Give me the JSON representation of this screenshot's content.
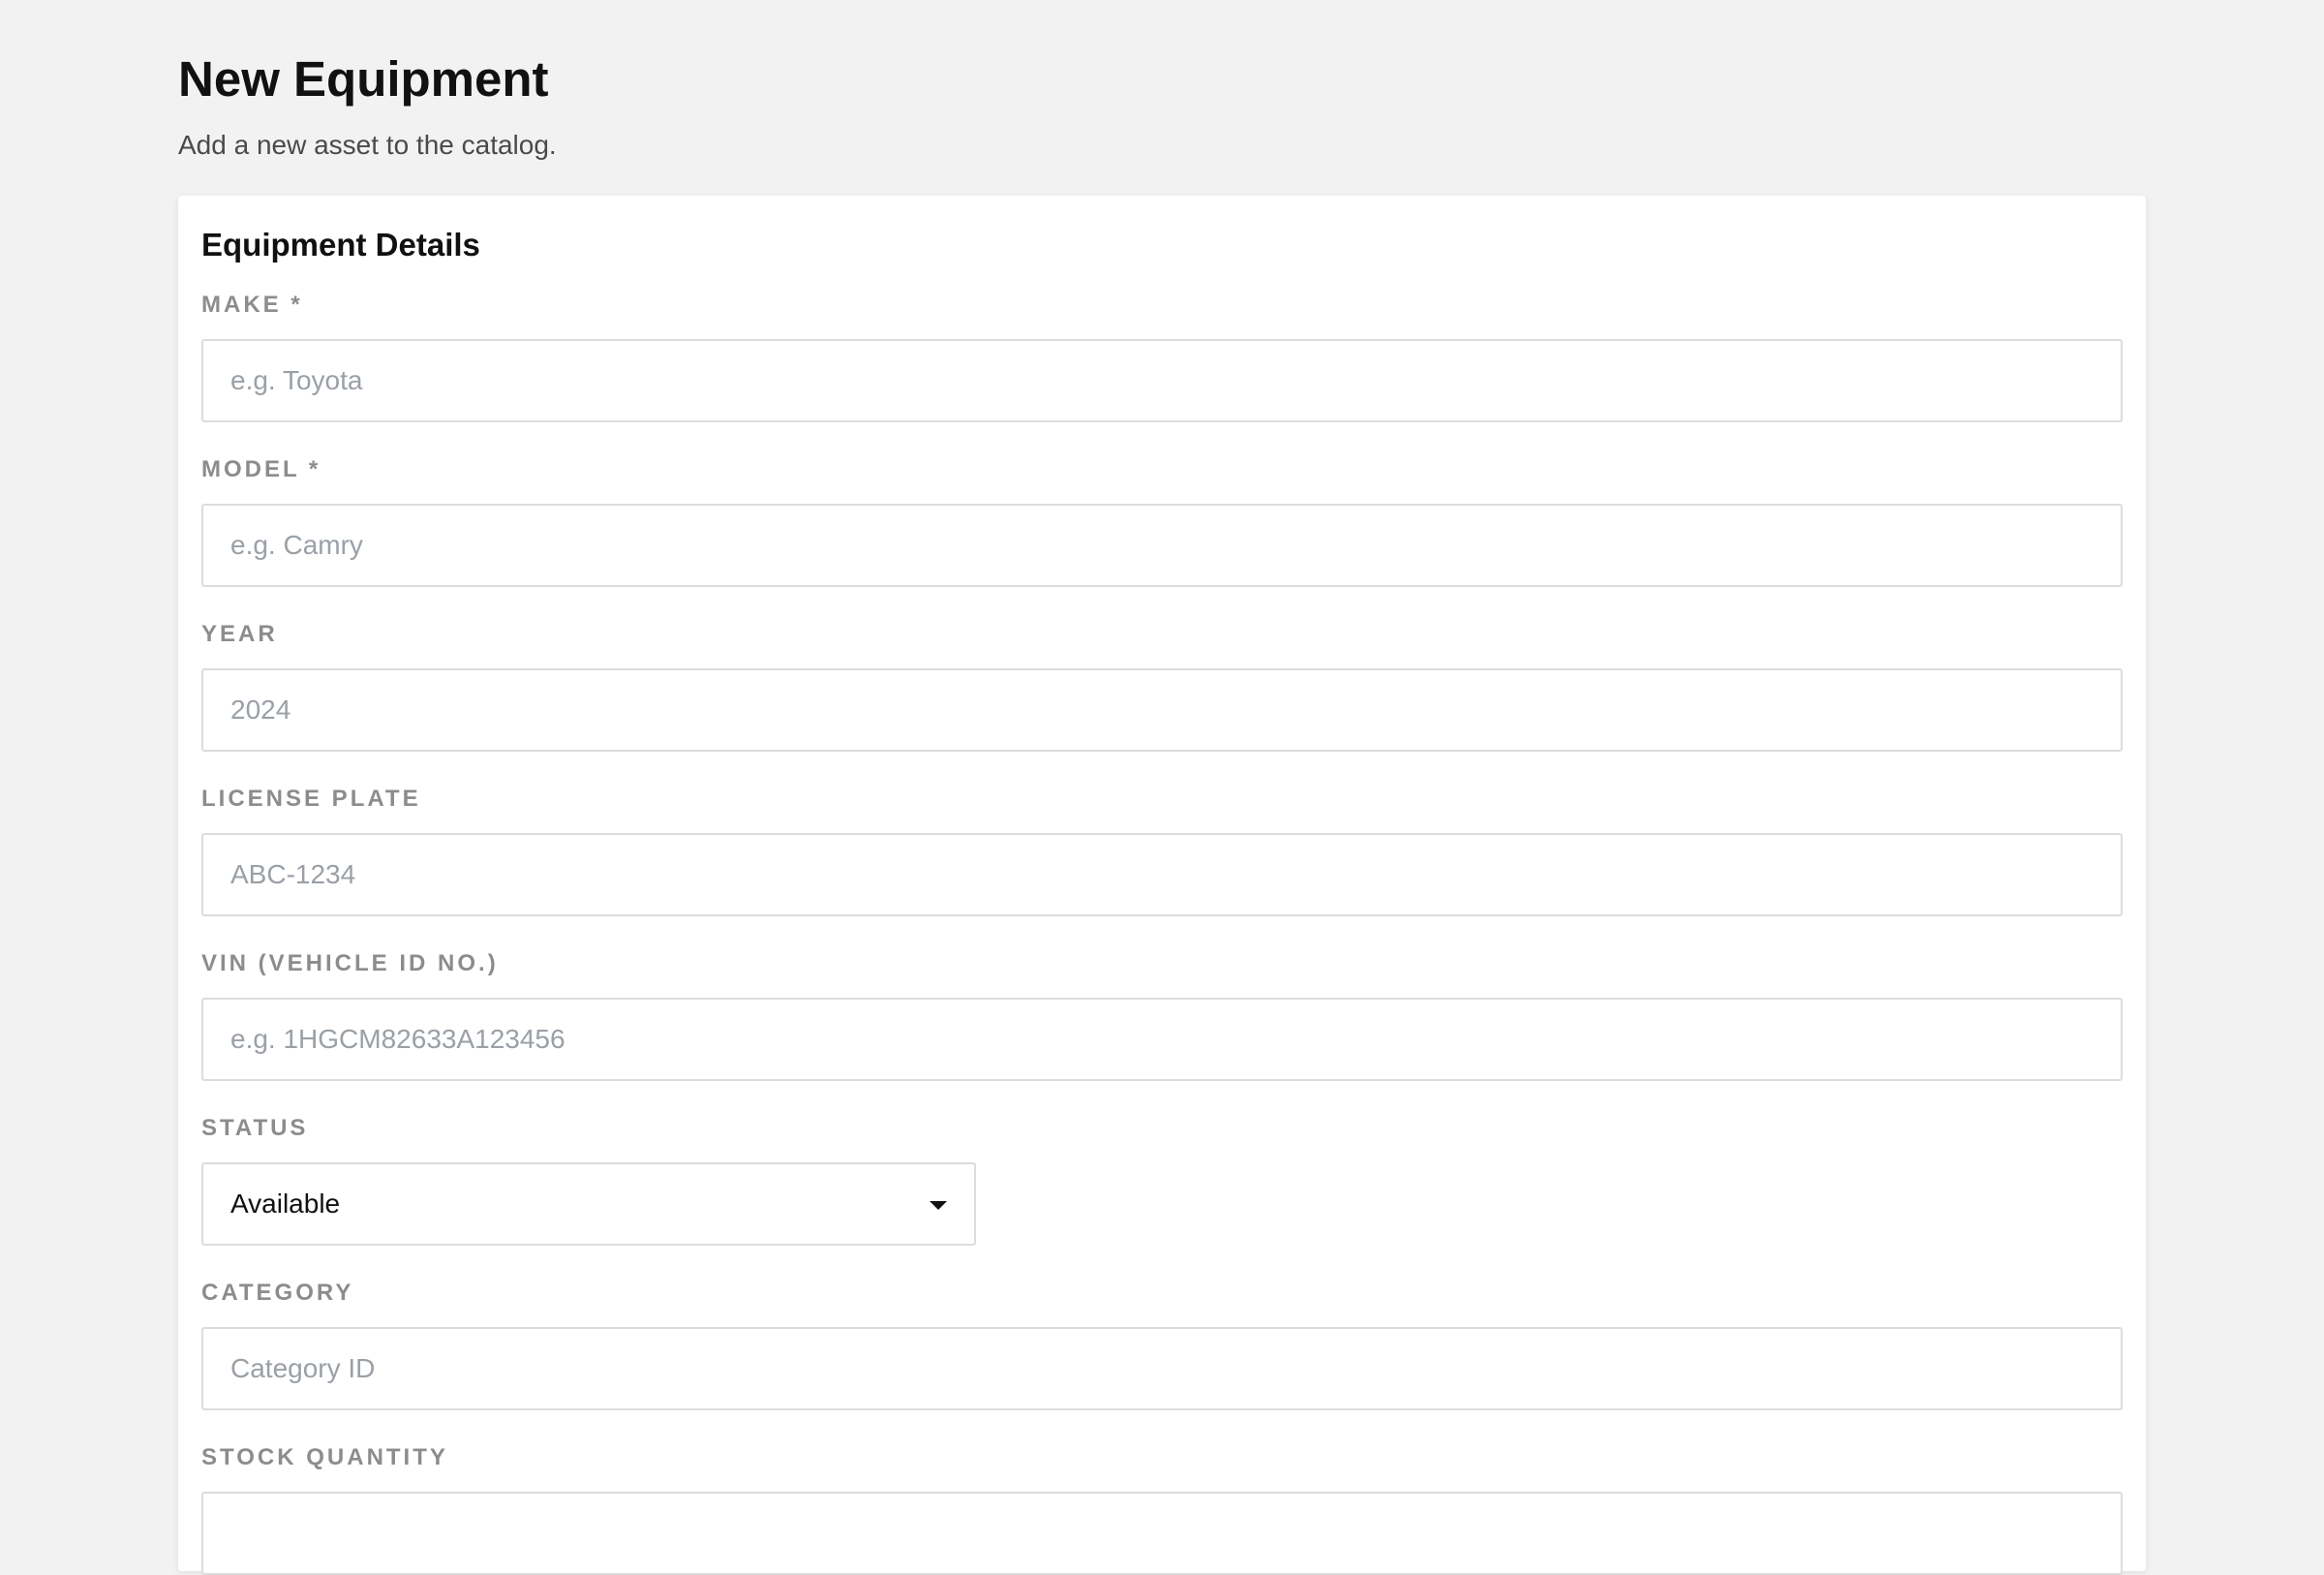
{
  "header": {
    "title": "New Equipment",
    "subtitle": "Add a new asset to the catalog."
  },
  "card": {
    "title": "Equipment Details"
  },
  "fields": {
    "make": {
      "label": "MAKE *",
      "value": "",
      "placeholder": "e.g. Toyota"
    },
    "model": {
      "label": "MODEL *",
      "value": "",
      "placeholder": "e.g. Camry"
    },
    "year": {
      "label": "YEAR",
      "value": "",
      "placeholder": "2024"
    },
    "license_plate": {
      "label": "LICENSE PLATE",
      "value": "",
      "placeholder": "ABC-1234"
    },
    "vin": {
      "label": "VIN (VEHICLE ID NO.)",
      "value": "",
      "placeholder": "e.g. 1HGCM82633A123456"
    },
    "status": {
      "label": "STATUS",
      "selected": "Available",
      "icon": "chevron-down-icon"
    },
    "category": {
      "label": "CATEGORY",
      "value": "",
      "placeholder": "Category ID"
    },
    "stock_quantity": {
      "label": "STOCK QUANTITY",
      "value": "",
      "placeholder": ""
    }
  },
  "colors": {
    "background": "#f2f2f2",
    "card": "#ffffff",
    "label": "#8c8c8c",
    "placeholder": "#9aa0a6",
    "border": "#dcdcdc"
  }
}
